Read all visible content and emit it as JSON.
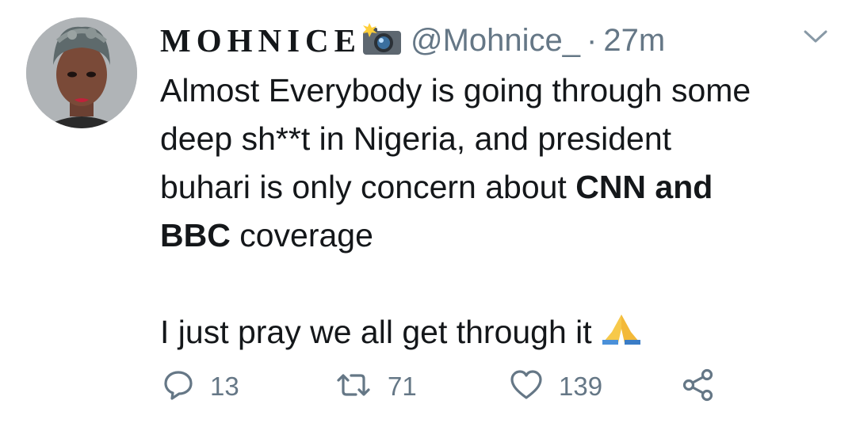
{
  "tweet": {
    "display_name": "MOHNICE",
    "display_name_emoji": "camera-with-flash-icon",
    "handle": "@Mohnice_",
    "separator": "·",
    "time": "27m",
    "body": {
      "line1": "Almost Everybody is going through some",
      "line2": "deep sh**t in Nigeria, and president",
      "line3_plain": "buhari is only concern about ",
      "line3_bold": "CNN and",
      "line4_bold": "BBC",
      "line4_plain": " coverage",
      "line5": "I just pray we all get through it",
      "line5_emoji": "folded-hands-icon"
    }
  },
  "actions": {
    "reply_count": "13",
    "retweet_count": "71",
    "like_count": "139"
  },
  "colors": {
    "text": "#14171a",
    "secondary": "#657786",
    "background": "#ffffff"
  }
}
